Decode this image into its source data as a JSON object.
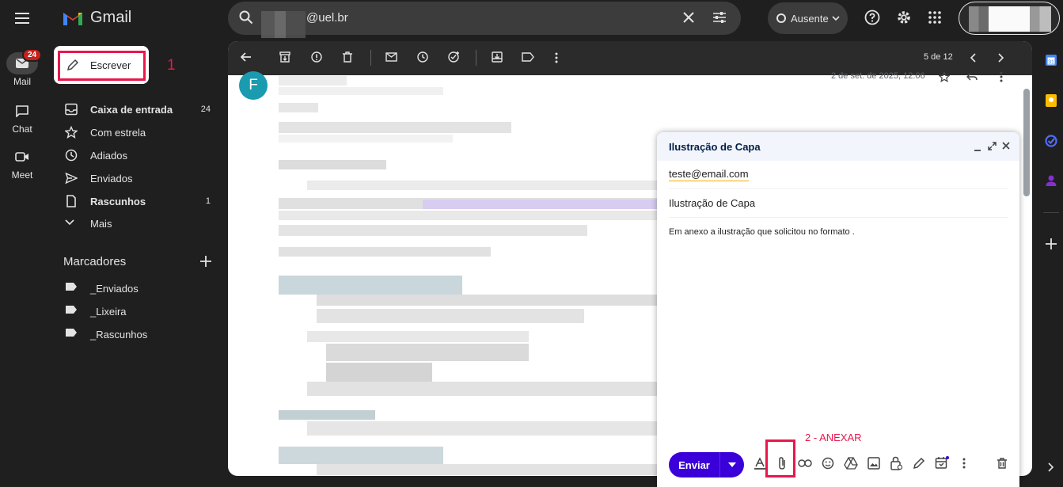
{
  "app": {
    "name": "Gmail"
  },
  "rail": {
    "mail_label": "Mail",
    "mail_badge": "24",
    "chat_label": "Chat",
    "meet_label": "Meet"
  },
  "search": {
    "query": "@uel.br"
  },
  "status": {
    "label": "Ausente"
  },
  "compose_button": {
    "label": "Escrever"
  },
  "nav": {
    "items": [
      {
        "label": "Caixa de entrada",
        "count": "24",
        "bold": true
      },
      {
        "label": "Com estrela",
        "count": ""
      },
      {
        "label": "Adiados",
        "count": ""
      },
      {
        "label": "Enviados",
        "count": ""
      },
      {
        "label": "Rascunhos",
        "count": "1",
        "bold": true
      },
      {
        "label": "Mais",
        "count": ""
      }
    ]
  },
  "labels": {
    "title": "Marcadores",
    "items": [
      "_Enviados",
      "_Lixeira",
      "_Rascunhos"
    ]
  },
  "toolbar": {
    "pagination": "5 de 12"
  },
  "message": {
    "sender_initial": "F",
    "date": "2 de set. de 2025, 12:06"
  },
  "compose": {
    "title": "Ilustração de Capa",
    "to": "teste@email.com",
    "subject": "Ilustração de Capa",
    "body": "Em anexo a ilustração que solicitou no formato .",
    "send_label": "Enviar"
  },
  "annotations": {
    "step1": "1",
    "step2": "2 - ANEXAR",
    "color": "#e8174c"
  },
  "colors": {
    "background": "#1f1f1f",
    "send_button": "#3b00d9",
    "avatar": "#1a9baf"
  }
}
